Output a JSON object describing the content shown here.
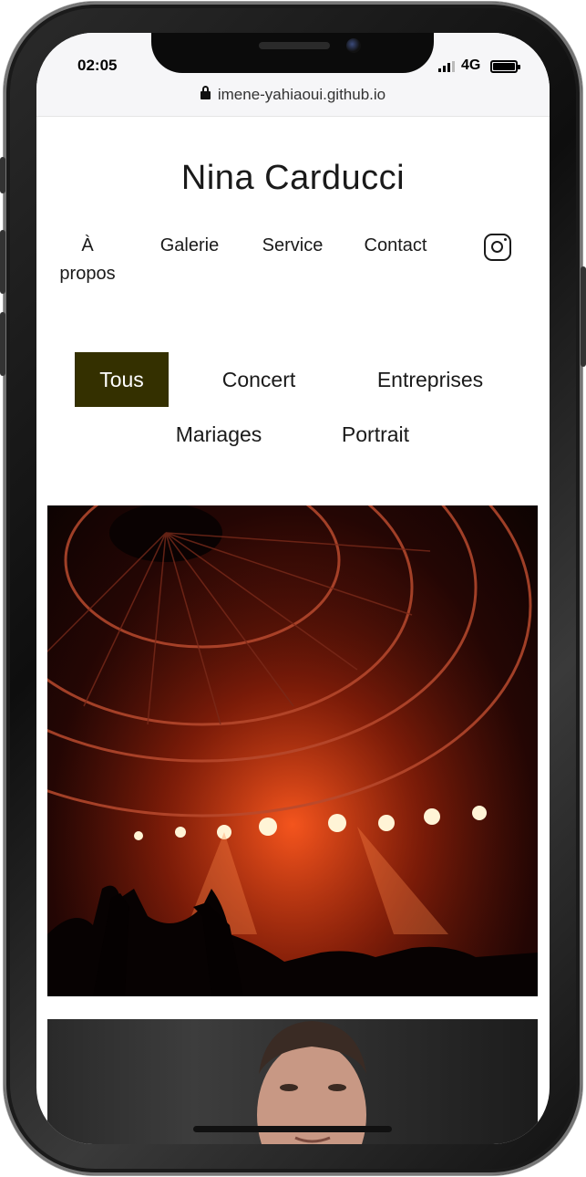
{
  "status": {
    "time": "02:05",
    "network": "4G",
    "url": "imene-yahiaoui.github.io"
  },
  "site": {
    "title": "Nina Carducci"
  },
  "nav": {
    "items": [
      {
        "label": "À\npropos"
      },
      {
        "label": "Galerie"
      },
      {
        "label": "Service"
      },
      {
        "label": "Contact"
      }
    ],
    "social_icon": "instagram-icon"
  },
  "filters": {
    "items": [
      {
        "label": "Tous",
        "active": true
      },
      {
        "label": "Concert",
        "active": false
      },
      {
        "label": "Entreprises",
        "active": false
      },
      {
        "label": "Mariages",
        "active": false
      },
      {
        "label": "Portrait",
        "active": false
      }
    ],
    "active_bg": "#343000"
  },
  "gallery": {
    "images": [
      "concert-photo",
      "portrait-photo"
    ]
  }
}
